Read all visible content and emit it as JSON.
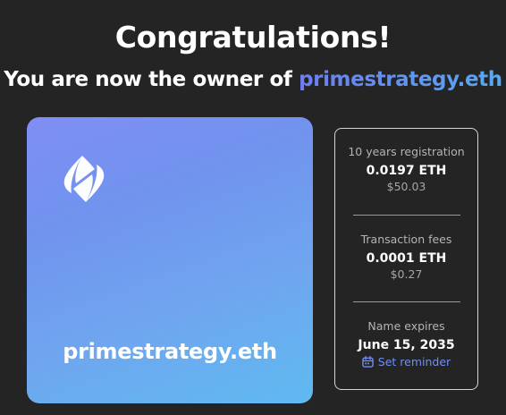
{
  "header": {
    "title": "Congratulations!",
    "subtitle_prefix": "You are now the owner of",
    "domain_name": "primestrategy.eth"
  },
  "card": {
    "name": "primestrategy.eth",
    "logo_icon": "ens-logo-icon"
  },
  "summary": {
    "registration": {
      "label": "10 years registration",
      "eth": "0.0197 ETH",
      "usd": "$50.03"
    },
    "fees": {
      "label": "Transaction fees",
      "eth": "0.0001 ETH",
      "usd": "$0.27"
    },
    "expiry": {
      "label": "Name expires",
      "date": "June 15, 2035",
      "reminder_label": "Set reminder",
      "reminder_icon": "calendar-icon"
    }
  },
  "colors": {
    "background": "#242424",
    "accent": "#6f8ef4",
    "card_gradient_start": "#7f8ef4",
    "card_gradient_end": "#5fbaf1"
  }
}
